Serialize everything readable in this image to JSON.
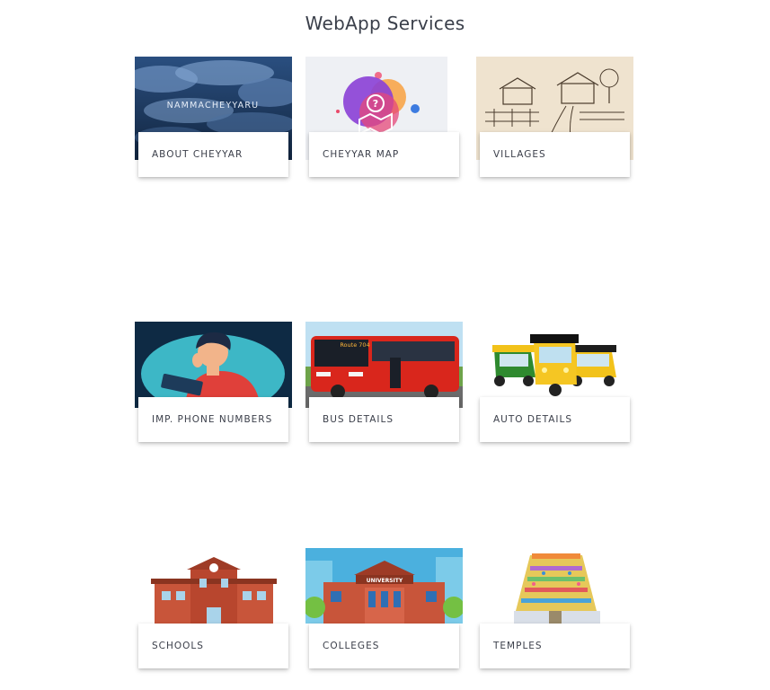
{
  "page": {
    "title": "WebApp Services"
  },
  "services": [
    {
      "label": "ABOUT CHEYYAR",
      "thumb_text": "NAMMACHEYYARU",
      "icon": "storm-clouds-image"
    },
    {
      "label": "CHEYYAR MAP",
      "icon": "map-question-icon"
    },
    {
      "label": "VILLAGES",
      "icon": "village-sketch-image"
    },
    {
      "label": "IMP. PHONE NUMBERS",
      "icon": "man-on-phone-image"
    },
    {
      "label": "BUS DETAILS",
      "bus_sign": "Route 704",
      "icon": "red-bus-image"
    },
    {
      "label": "AUTO DETAILS",
      "icon": "auto-rickshaw-image"
    },
    {
      "label": "SCHOOLS",
      "icon": "school-building-image"
    },
    {
      "label": "COLLEGES",
      "building_sign": "UNIVERSITY",
      "icon": "university-building-image"
    },
    {
      "label": "TEMPLES",
      "icon": "temple-tower-image"
    }
  ],
  "colors": {
    "title": "#3a3f4a",
    "label": "#3b3f4a",
    "card": "#ffffff",
    "bus": "#d9261c",
    "brick": "#c8553a"
  }
}
